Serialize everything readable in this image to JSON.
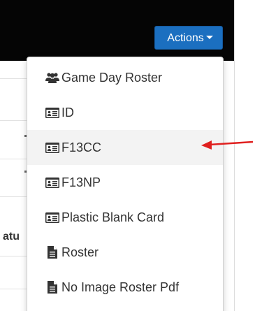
{
  "header": {
    "actions_button": {
      "label": "Actions",
      "icon": "caret-down-icon"
    }
  },
  "background": {
    "partial_heading": "atu"
  },
  "dropdown": {
    "items": [
      {
        "label": "Game Day Roster",
        "icon": "users-icon"
      },
      {
        "label": "ID",
        "icon": "id-card-icon"
      },
      {
        "label": "F13CC",
        "icon": "id-card-icon",
        "highlighted": true
      },
      {
        "label": "F13NP",
        "icon": "id-card-icon"
      },
      {
        "label": "Plastic Blank Card",
        "icon": "id-card-icon"
      },
      {
        "label": "Roster",
        "icon": "file-icon"
      },
      {
        "label": "No Image Roster Pdf",
        "icon": "file-icon"
      }
    ]
  },
  "annotation": {
    "arrow_color": "#e0201f"
  },
  "colors": {
    "header": "#050505",
    "button": "#1b6fc0",
    "menu_text": "#333333",
    "highlight": "#f3f3f3"
  }
}
